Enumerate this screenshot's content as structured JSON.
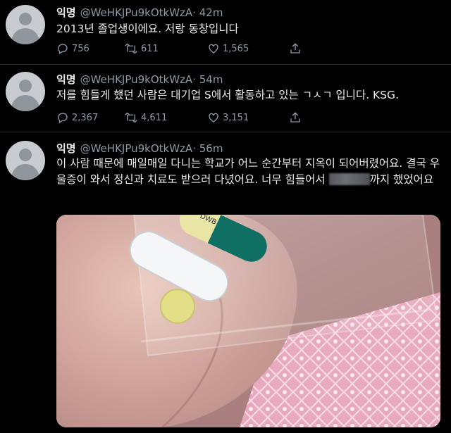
{
  "tweets": [
    {
      "name": "익명",
      "handle": "@WeHKJPu9kOtkWzA",
      "time": "· 42m",
      "text": "2013년 졸업생이에요. 저랑 동창입니다",
      "replies": "756",
      "retweets": "611",
      "likes": "1,565"
    },
    {
      "name": "익명",
      "handle": "@WeHKJPu9kOtkWzA",
      "time": "· 54m",
      "text": "저를 힘들게 했던 사람은 대기업 S에서 활동하고 있는 ㄱㅅㄱ 입니다. KSG.",
      "replies": "2,367",
      "retweets": "4,611",
      "likes": "3,151"
    },
    {
      "name": "익명",
      "handle": "@WeHKJPu9kOtkWzA",
      "time": "· 56m",
      "text_before_blur": "이 사람 때문에 매일매일 다니는 학교가 어느 순간부터 지옥이 되어버렸어요. 결국 우울증이 와서 정신과 치료도 받으러 다녔어요. 너무 힘들어서 ",
      "text_after_blur": "까지 했었어요",
      "capsule_print": "DWB"
    }
  ],
  "icons": {
    "reply": "reply-bubble-icon",
    "retweet": "retweet-arrows-icon",
    "like": "heart-outline-icon",
    "share": "share-upload-icon"
  },
  "colors": {
    "background": "#000000",
    "text": "#e7e9ea",
    "secondary": "#8b98a5",
    "divider": "#2a2d31"
  }
}
